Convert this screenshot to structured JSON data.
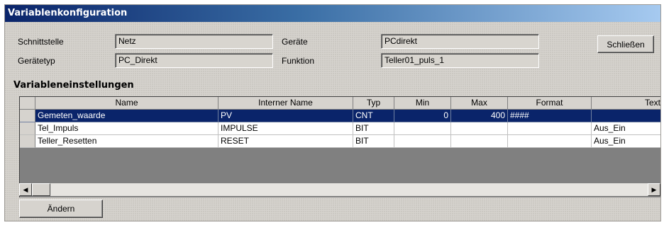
{
  "window": {
    "title": "Variablenkonfiguration"
  },
  "fields": {
    "schnittstelle": {
      "label": "Schnittstelle",
      "value": "Netz"
    },
    "geraetetyp": {
      "label": "Gerätetyp",
      "value": "PC_Direkt"
    },
    "geraete": {
      "label": "Geräte",
      "value": "PCdirekt"
    },
    "funktion": {
      "label": "Funktion",
      "value": "Teller01_puls_1"
    }
  },
  "buttons": {
    "close": "Schließen",
    "change": "Ändern"
  },
  "section": {
    "title": "Variableneinstellungen"
  },
  "grid": {
    "columns": [
      "Name",
      "Interner Name",
      "Typ",
      "Min",
      "Max",
      "Format",
      "Text"
    ],
    "rows": [
      {
        "name": "Gemeten_waarde",
        "internal": "PV",
        "type": "CNT",
        "min": "0",
        "max": "400",
        "format": "####",
        "text": "",
        "selected": true
      },
      {
        "name": "Tel_Impuls",
        "internal": "IMPULSE",
        "type": "BIT",
        "min": "",
        "max": "",
        "format": "",
        "text": "Aus_Ein",
        "selected": false
      },
      {
        "name": "Teller_Resetten",
        "internal": "RESET",
        "type": "BIT",
        "min": "",
        "max": "",
        "format": "",
        "text": "Aus_Ein",
        "selected": false
      }
    ]
  },
  "icons": {
    "scroll_left": "arrow-left-icon",
    "scroll_right": "arrow-right-icon"
  }
}
